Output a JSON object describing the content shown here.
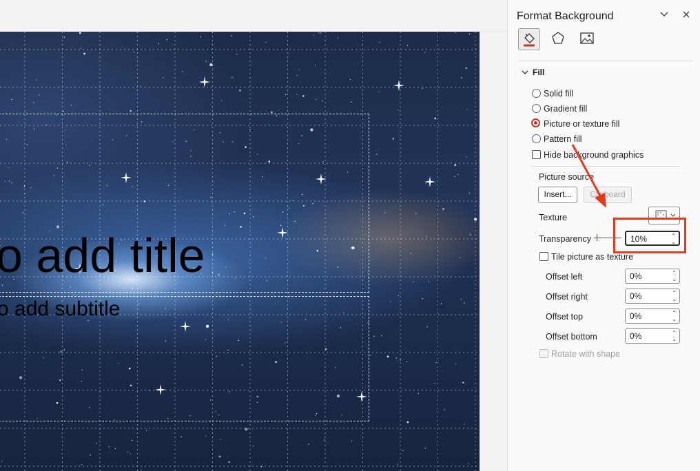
{
  "slide": {
    "title_fragment": "o add title",
    "subtitle_fragment": "o add subtitle"
  },
  "panel": {
    "title": "Format Background",
    "header_icons": [
      "chevron-down-icon",
      "close-icon"
    ],
    "tabs": [
      "fill-bucket-icon",
      "pentagon-icon",
      "picture-icon"
    ],
    "section_label": "Fill",
    "fill_options": [
      {
        "label": "Solid fill",
        "selected": false
      },
      {
        "label": "Gradient fill",
        "selected": false
      },
      {
        "label": "Picture or texture fill",
        "selected": true
      },
      {
        "label": "Pattern fill",
        "selected": false
      }
    ],
    "hide_graphics_label": "Hide background graphics",
    "picture_source_label": "Picture source",
    "insert_label": "Insert...",
    "clipboard_label": "Clipboard",
    "texture_label": "Texture",
    "transparency_label": "Transparency",
    "transparency_value": "10%",
    "tile_label": "Tile picture as texture",
    "offsets": [
      {
        "label": "Offset left",
        "value": "0%"
      },
      {
        "label": "Offset right",
        "value": "0%"
      },
      {
        "label": "Offset top",
        "value": "0%"
      },
      {
        "label": "Offset bottom",
        "value": "0%"
      }
    ],
    "rotate_label": "Rotate with shape"
  },
  "annotation": {
    "arrow_color": "#e53a1e",
    "box_color": "#e53a1e"
  }
}
